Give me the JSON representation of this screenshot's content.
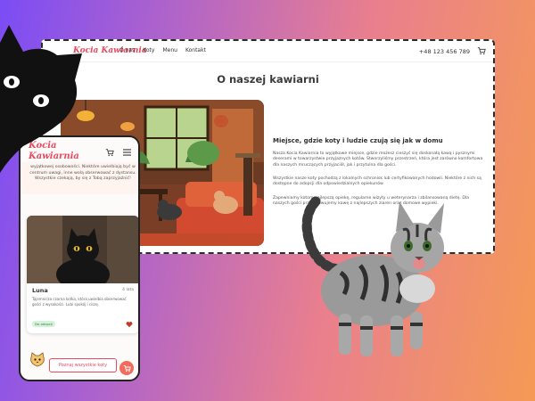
{
  "desktop": {
    "logo": "Kocia Kawiarnia",
    "nav": [
      "O nas",
      "Koty",
      "Menu",
      "Kontakt"
    ],
    "phone": "+48 123 456 789",
    "page_title": "O naszej kawiarni",
    "heading": "Miejsce, gdzie koty i ludzie czują się jak w domu",
    "paragraphs": [
      "Nasza Kocia Kawiarnia to wyjątkowe miejsce, gdzie możesz cieszyć się doskonałą kawą i pysznymi deserami w towarzystwie przyjaznych kotów. Stworzyliśmy przestrzeń, która jest zarówno komfortowa dla naszych mruczących przyjaciół, jak i przytulna dla gości.",
      "Wszystkie nasze koty pochodzą z lokalnych schronisk lub certyfikowanych hodowli. Niektóre z nich są dostępne do adopcji dla odpowiedzialnych opiekunów.",
      "Zapewniamy kotom najlepszą opiekę, regularne wizyty u weterynarza i zbilansowaną dietę. Dla naszych gości przygotowujemy kawę z najlepszych ziaren oraz domowe wypieki."
    ]
  },
  "mobile": {
    "logo_line1": "Kocia",
    "logo_line2": "Kawiarnia",
    "intro": "wyjątkowej osobowości. Niektóre uwielbiają być w centrum uwagi, inne wolą obserwować z dystansu. Wszystkie czekają, by się z Tobą zaprzyjaźnić!",
    "card": {
      "name": "Luna",
      "age": "4 lata",
      "description": "Tajemnicza czarna kotka, która uwielbia obserwować gości z wysokości. Lubi spokój i ciszę.",
      "badge": "Do adopcji"
    },
    "cta_button": "Poznaj wszystkie koty"
  },
  "colors": {
    "brand": "#e84a5f",
    "badge_bg": "#d7f2dc",
    "badge_text": "#2f8a3e",
    "fab": "#f26b5c"
  },
  "icons": [
    "cart-icon",
    "menu-icon",
    "heart-icon",
    "kitty-icon",
    "cart-fab-icon"
  ]
}
